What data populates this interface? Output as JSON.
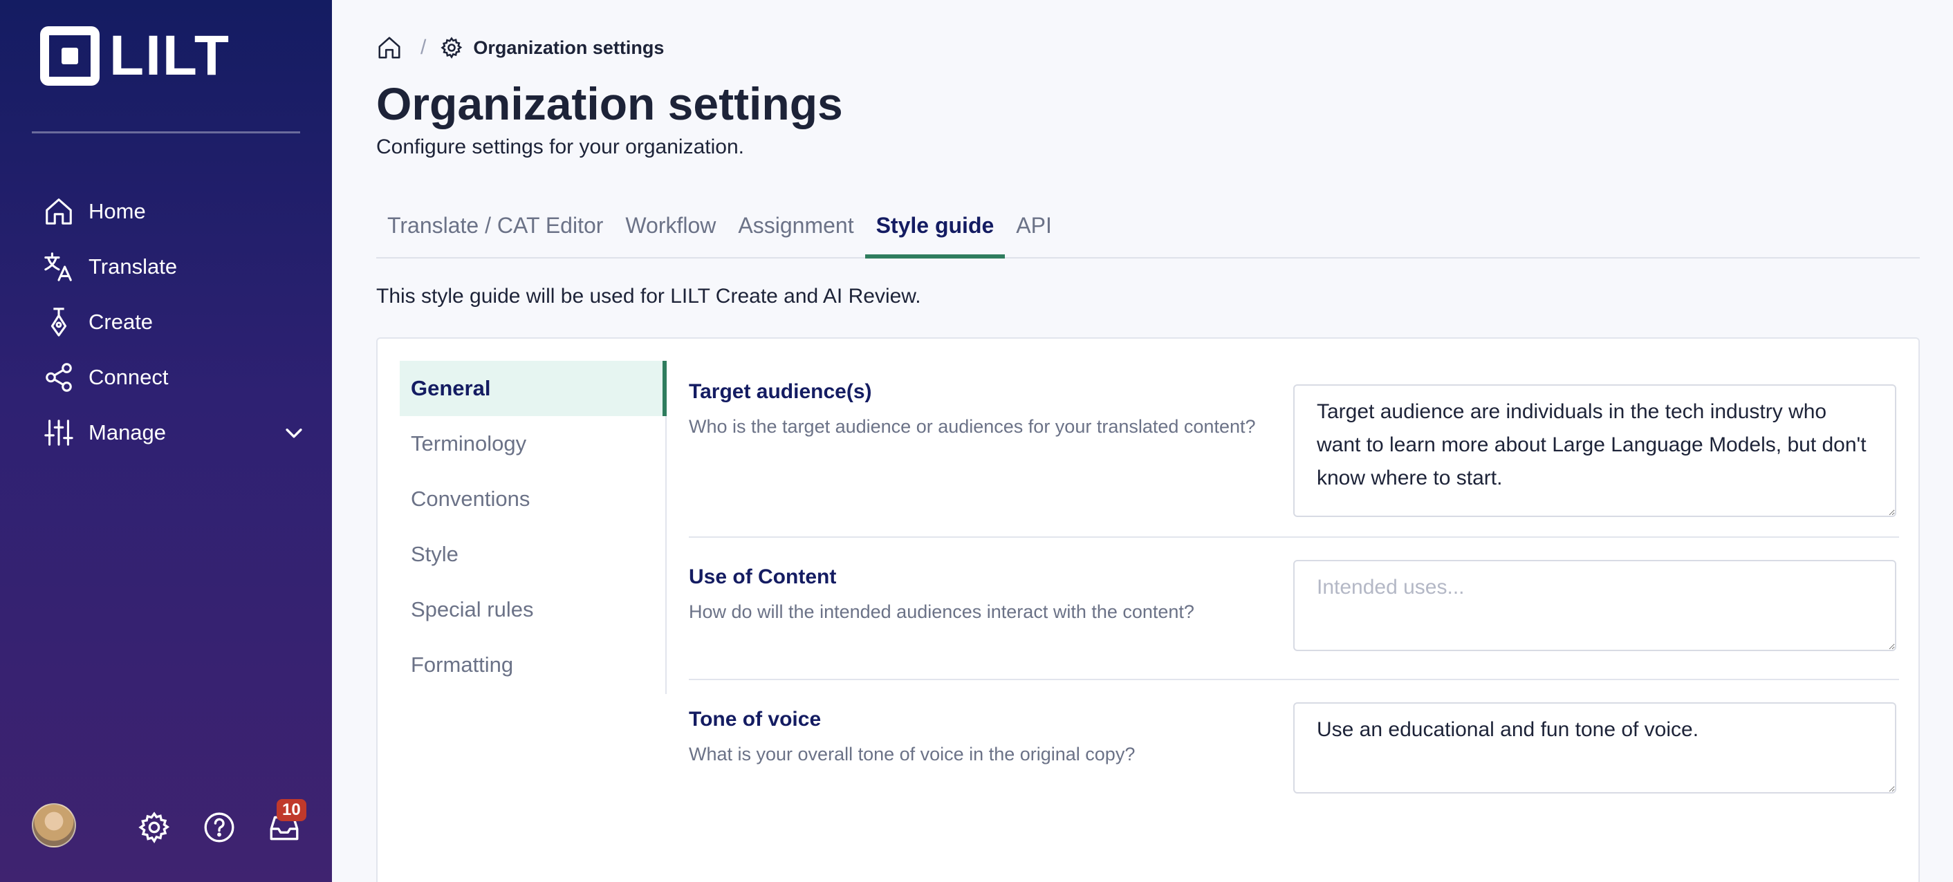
{
  "app": {
    "logo_text": "LILT"
  },
  "sidebar": {
    "items": [
      {
        "label": "Home"
      },
      {
        "label": "Translate"
      },
      {
        "label": "Create"
      },
      {
        "label": "Connect"
      },
      {
        "label": "Manage"
      }
    ],
    "notifications_count": "10"
  },
  "breadcrumb": {
    "current": "Organization settings"
  },
  "header": {
    "title": "Organization settings",
    "subtitle": "Configure settings for your organization."
  },
  "tabs": [
    {
      "label": "Translate / CAT Editor"
    },
    {
      "label": "Workflow"
    },
    {
      "label": "Assignment"
    },
    {
      "label": "Style guide",
      "active": true
    },
    {
      "label": "API"
    }
  ],
  "style_guide": {
    "note": "This style guide will be used for LILT Create and AI Review.",
    "sections": [
      {
        "label": "General",
        "active": true
      },
      {
        "label": "Terminology"
      },
      {
        "label": "Conventions"
      },
      {
        "label": "Style"
      },
      {
        "label": "Special rules"
      },
      {
        "label": "Formatting"
      }
    ],
    "fields": [
      {
        "label": "Target audience(s)",
        "help": "Who is the target audience or audiences for your translated content?",
        "value": "Target audience are individuals in the tech industry who want to learn more about Large Language Models, but don't know where to start.",
        "placeholder": ""
      },
      {
        "label": "Use of Content",
        "help": "How do will the intended audiences interact with the content?",
        "value": "",
        "placeholder": "Intended uses..."
      },
      {
        "label": "Tone of voice",
        "help": "What is your overall tone of voice in the original copy?",
        "value": "Use an educational and fun tone of voice.",
        "placeholder": ""
      }
    ]
  },
  "colors": {
    "accent": "#2f7d5e",
    "sidebar_top": "#141c62",
    "sidebar_bottom": "#3f2370",
    "badge": "#c0392b"
  }
}
